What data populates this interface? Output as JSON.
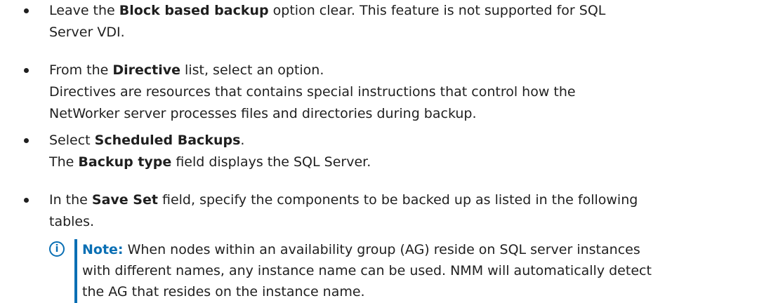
{
  "bullets": [
    {
      "lines": [
        {
          "before": "Leave the ",
          "bold": "Block based backup",
          "after": " option clear. This feature is not supported for SQL"
        },
        {
          "before": "Server VDI.",
          "bold": "",
          "after": ""
        }
      ]
    },
    {
      "lines": [
        {
          "before": "From the ",
          "bold": "Directive",
          "after": " list, select an option."
        },
        {
          "before": "Directives are resources that contains special instructions that control how the",
          "bold": "",
          "after": ""
        },
        {
          "before": "NetWorker server processes files and directories during backup.",
          "bold": "",
          "after": ""
        }
      ]
    },
    {
      "lines": [
        {
          "before": "Select ",
          "bold": "Scheduled Backups",
          "after": "."
        },
        {
          "before": "The ",
          "bold": "Backup type",
          "after": " field displays the SQL Server."
        }
      ]
    },
    {
      "lines": [
        {
          "before": "In the ",
          "bold": "Save Set",
          "after": " field, specify the components to be backed up as listed in the following"
        },
        {
          "before": "tables.",
          "bold": "",
          "after": ""
        }
      ]
    }
  ],
  "note": {
    "label": "Note:",
    "icon": "info-icon",
    "lines": [
      " When nodes within an availability group (AG) reside on SQL server instances",
      "with different names, any instance name can be used. NMM will automatically detect",
      "the AG that resides on the instance name."
    ]
  }
}
